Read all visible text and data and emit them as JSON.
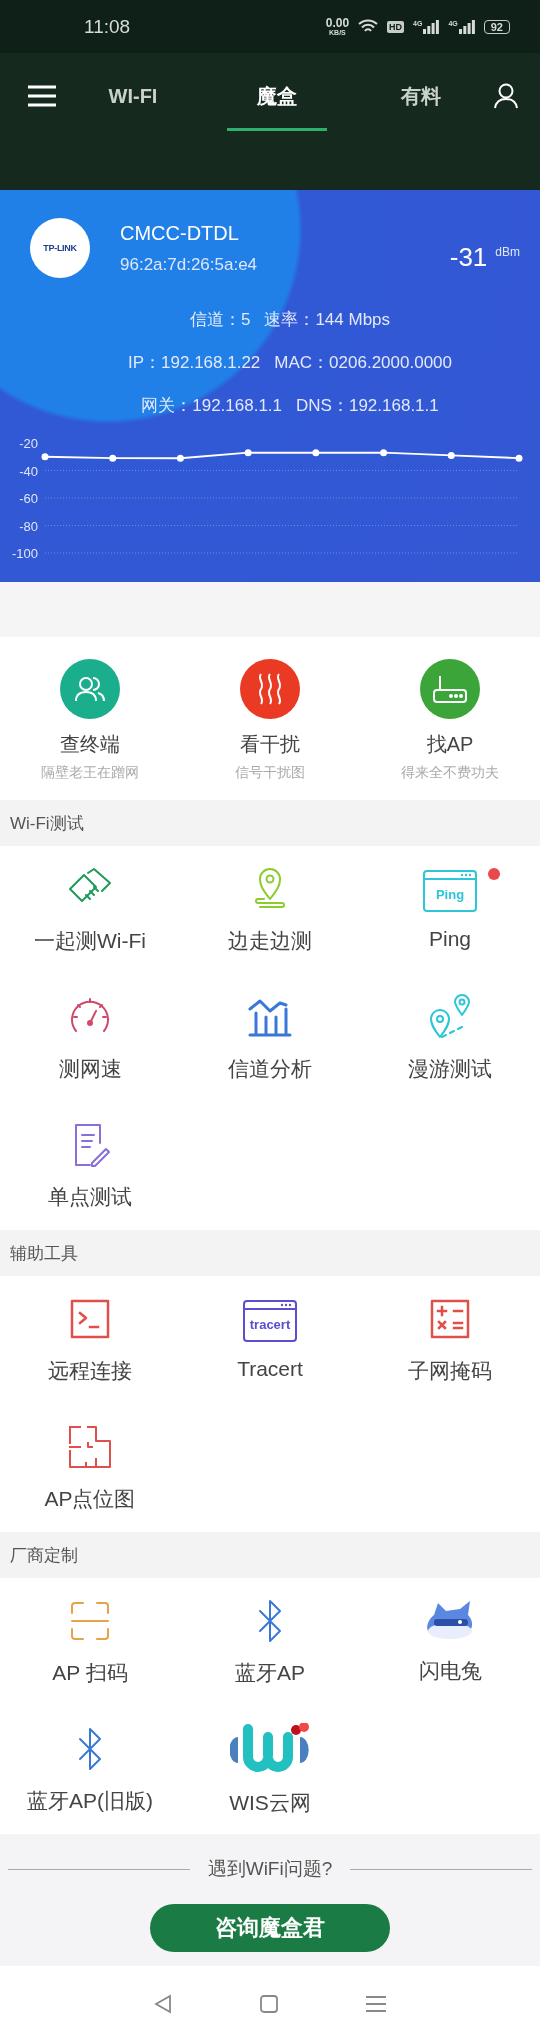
{
  "status_bar": {
    "time": "11:08",
    "net_speed": "0.00",
    "net_unit": "KB/S",
    "hd": "HD",
    "signals": [
      "4G",
      "4G"
    ],
    "battery": "92"
  },
  "tabs": [
    {
      "label": "WI-FI",
      "selected": false
    },
    {
      "label": "魔盒",
      "selected": true
    },
    {
      "label": "有料",
      "selected": false
    }
  ],
  "network": {
    "logo_text": "TP-LINK",
    "ssid": "CMCC-DTDL",
    "bssid": "96:2a:7d:26:5a:e4",
    "rssi": "-31",
    "rssi_unit": "dBm",
    "lines": [
      {
        "fields": [
          "信道：5",
          "速率：144 Mbps"
        ]
      },
      {
        "fields": [
          "IP：192.168.1.22",
          "MAC：0206.2000.0000"
        ]
      },
      {
        "fields": [
          "网关：192.168.1.1",
          "DNS：192.168.1.1"
        ]
      }
    ],
    "chart_data": {
      "type": "line",
      "grid": true,
      "ylim": [
        -100,
        -20
      ],
      "yticks": [
        -20,
        -40,
        -60,
        -80,
        -100
      ],
      "series": [
        {
          "color": "#ffffff",
          "marker": true,
          "values": [
            -30,
            -31,
            -31,
            -27,
            -27,
            -27,
            -29,
            -31
          ]
        }
      ]
    }
  },
  "features": [
    {
      "kind": "people",
      "title": "查终端",
      "subtitle": "隔壁老王在蹭网",
      "color": "#1aae8c"
    },
    {
      "kind": "heat",
      "title": "看干扰",
      "subtitle": "信号干扰图",
      "color": "#ea3a24"
    },
    {
      "kind": "router",
      "title": "找AP",
      "subtitle": "得来全不费功夫",
      "color": "#3ba53a"
    }
  ],
  "sections": [
    {
      "title": "Wi-Fi测试",
      "items": [
        {
          "kind": "handshake",
          "label": "一起测Wi-Fi",
          "unread": false
        },
        {
          "kind": "location",
          "label": "边走边测",
          "unread": false
        },
        {
          "kind": "window",
          "label": "Ping",
          "icon_text": "Ping",
          "unread": true
        },
        {
          "kind": "gauge",
          "label": "测网速",
          "unread": false
        },
        {
          "kind": "bars",
          "label": "信道分析",
          "unread": false
        },
        {
          "kind": "roaming",
          "label": "漫游测试",
          "unread": false
        },
        {
          "kind": "note",
          "label": "单点测试",
          "unread": false
        }
      ]
    },
    {
      "title": "辅助工具",
      "items": [
        {
          "kind": "terminal",
          "label": "远程连接",
          "unread": false
        },
        {
          "kind": "window2",
          "label": "Tracert",
          "icon_text": "tracert",
          "unread": false
        },
        {
          "kind": "calculator",
          "label": "子网掩码",
          "unread": false
        },
        {
          "kind": "floorplan",
          "label": "AP点位图",
          "unread": false
        }
      ]
    },
    {
      "title": "厂商定制",
      "items": [
        {
          "kind": "scan",
          "label": "AP 扫码",
          "unread": false
        },
        {
          "kind": "bluetooth",
          "label": "蓝牙AP",
          "unread": false
        },
        {
          "kind": "rabbit",
          "label": "闪电兔",
          "unread": false
        },
        {
          "kind": "bluetooth",
          "label": "蓝牙AP(旧版)",
          "unread": false
        },
        {
          "kind": "wis",
          "label": "WIS云网",
          "unread": false
        }
      ]
    }
  ],
  "footer": {
    "question": "遇到WiFi问题?",
    "button": "咨询魔盒君"
  }
}
